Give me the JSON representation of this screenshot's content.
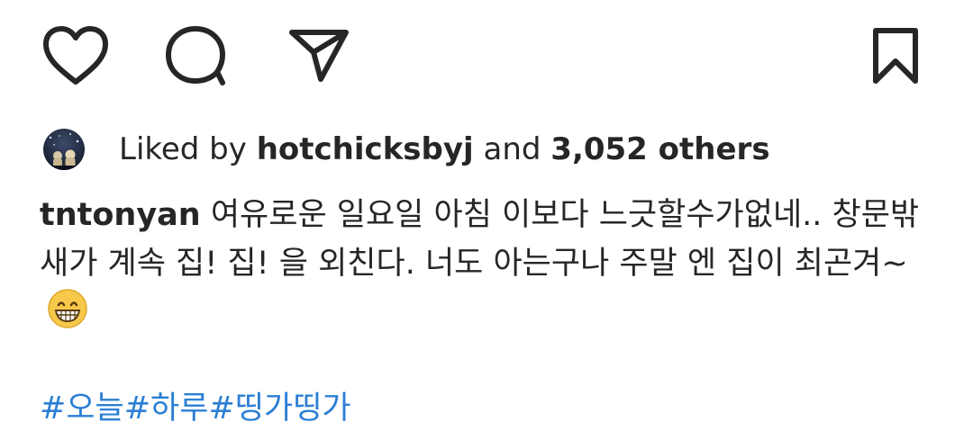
{
  "actions": {
    "like_icon": "heart-outline-icon",
    "comment_icon": "speech-bubble-icon",
    "share_icon": "paper-plane-icon",
    "save_icon": "bookmark-outline-icon"
  },
  "likes": {
    "prefix": "Liked by",
    "user": "hotchicksbyj",
    "conjunction": "and",
    "others": "3,052 others"
  },
  "caption": {
    "username": "tntonyan",
    "text": "여유로운 일요일 아침 이보다 느긋할수가없네.. 창문밖 새가 계속 집! 집!  을 외친다. 너도 아는구나 주말 엔 집이 최곤겨~",
    "emoji": "grinning-face-icon"
  },
  "hashtags": [
    "#오늘",
    "#하루",
    "#띵가띵가"
  ],
  "colors": {
    "text": "#262626",
    "hashtag": "#2b7fd4",
    "background": "#ffffff"
  }
}
